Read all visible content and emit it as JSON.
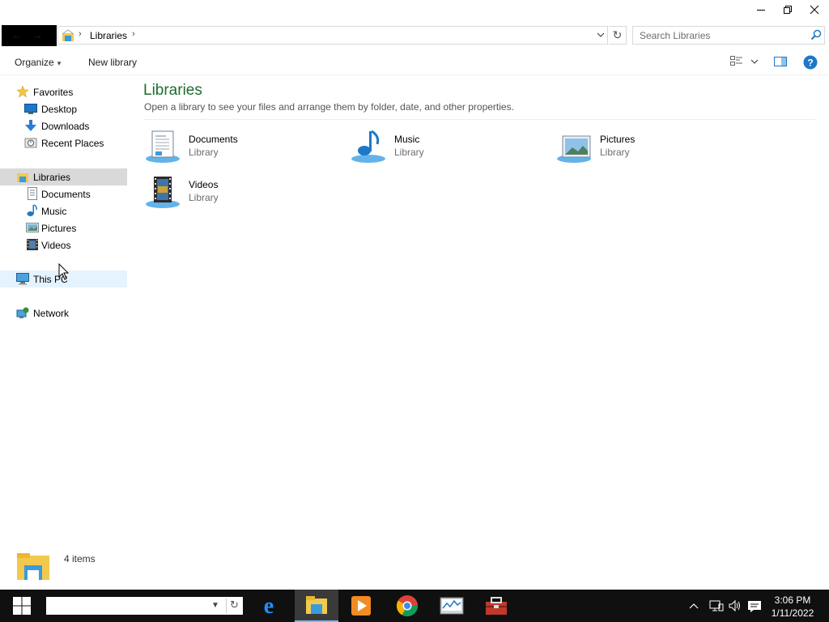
{
  "window": {
    "controls": [
      "minimize-icon",
      "restore-icon",
      "close-icon"
    ]
  },
  "address": {
    "crumb": "Libraries",
    "separator": "›"
  },
  "search": {
    "placeholder": "Search Libraries"
  },
  "commandbar": {
    "organize": "Organize",
    "new_library": "New library"
  },
  "navpane": {
    "items": [
      {
        "label": "Favorites",
        "icon": "star-icon"
      },
      {
        "label": "Desktop",
        "icon": "desktop-icon"
      },
      {
        "label": "Downloads",
        "icon": "download-arrow-icon"
      },
      {
        "label": "Recent Places",
        "icon": "recent-places-icon"
      },
      {
        "label": "Libraries",
        "icon": "libraries-icon",
        "state": "selected"
      },
      {
        "label": "Documents",
        "icon": "documents-icon"
      },
      {
        "label": "Music",
        "icon": "music-note-icon"
      },
      {
        "label": "Pictures",
        "icon": "pictures-icon"
      },
      {
        "label": "Videos",
        "icon": "film-icon"
      },
      {
        "label": "This PC",
        "icon": "monitor-icon",
        "state": "hover"
      },
      {
        "label": "Network",
        "icon": "network-icon"
      }
    ]
  },
  "main": {
    "title": "Libraries",
    "subtitle": "Open a library to see your files and arrange them by folder, date, and other properties.",
    "libraries": [
      {
        "name": "Documents",
        "type": "Library",
        "icon": "documents-icon"
      },
      {
        "name": "Music",
        "type": "Library",
        "icon": "music-note-icon"
      },
      {
        "name": "Pictures",
        "type": "Library",
        "icon": "pictures-icon"
      },
      {
        "name": "Videos",
        "type": "Library",
        "icon": "film-icon"
      }
    ]
  },
  "details": {
    "count": "4 items"
  },
  "taskbar": {
    "search_value": "",
    "apps": [
      "edge-icon",
      "file-explorer-icon",
      "media-player-icon",
      "chrome-icon",
      "performance-monitor-icon",
      "toolbox-icon"
    ],
    "active_app": "file-explorer-icon",
    "time": "3:06 PM",
    "date": "1/11/2022"
  },
  "colors": {
    "title_green": "#1e6e2e",
    "selected_bg": "#d9d9d9",
    "hover_bg": "#e5f3ff",
    "taskbar_bg": "#101010",
    "accent_blue": "#1e78c8"
  }
}
